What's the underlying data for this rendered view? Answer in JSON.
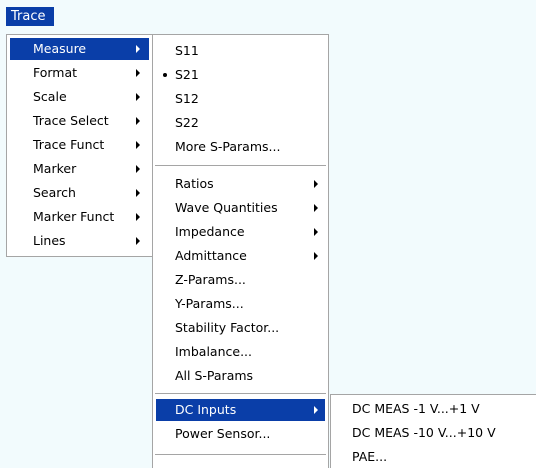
{
  "menubar": {
    "trace_label": "Trace"
  },
  "trace_menu": {
    "items": [
      {
        "label": "Measure",
        "submenu": true,
        "highlighted": true
      },
      {
        "label": "Format",
        "submenu": true
      },
      {
        "label": "Scale",
        "submenu": true
      },
      {
        "label": "Trace Select",
        "submenu": true
      },
      {
        "label": "Trace Funct",
        "submenu": true
      },
      {
        "label": "Marker",
        "submenu": true
      },
      {
        "label": "Search",
        "submenu": true
      },
      {
        "label": "Marker Funct",
        "submenu": true
      },
      {
        "label": "Lines",
        "submenu": true
      }
    ]
  },
  "measure_menu": {
    "group1": [
      {
        "label": "S11"
      },
      {
        "label": "S21",
        "checked": true
      },
      {
        "label": "S12"
      },
      {
        "label": "S22"
      },
      {
        "label": "More S-Params..."
      }
    ],
    "group2": [
      {
        "label": "Ratios",
        "submenu": true
      },
      {
        "label": "Wave Quantities",
        "submenu": true
      },
      {
        "label": "Impedance",
        "submenu": true
      },
      {
        "label": "Admittance",
        "submenu": true
      },
      {
        "label": "Z-Params..."
      },
      {
        "label": "Y-Params..."
      },
      {
        "label": "Stability Factor..."
      },
      {
        "label": "Imbalance..."
      },
      {
        "label": "All S-Params"
      }
    ],
    "group3": [
      {
        "label": "DC Inputs",
        "submenu": true,
        "highlighted": true
      },
      {
        "label": "Power Sensor..."
      }
    ]
  },
  "dc_inputs_menu": {
    "items": [
      {
        "label": "DC MEAS -1 V...+1 V"
      },
      {
        "label": "DC MEAS -10 V...+10 V"
      },
      {
        "label": "PAE..."
      }
    ]
  },
  "colors": {
    "highlight": "#0a3ea8",
    "background": "#f2fbfd",
    "menu_border": "#a5a5a5"
  },
  "icons": {
    "submenu_arrow": "chevron-right-icon",
    "check_bullet": "bullet-icon"
  }
}
